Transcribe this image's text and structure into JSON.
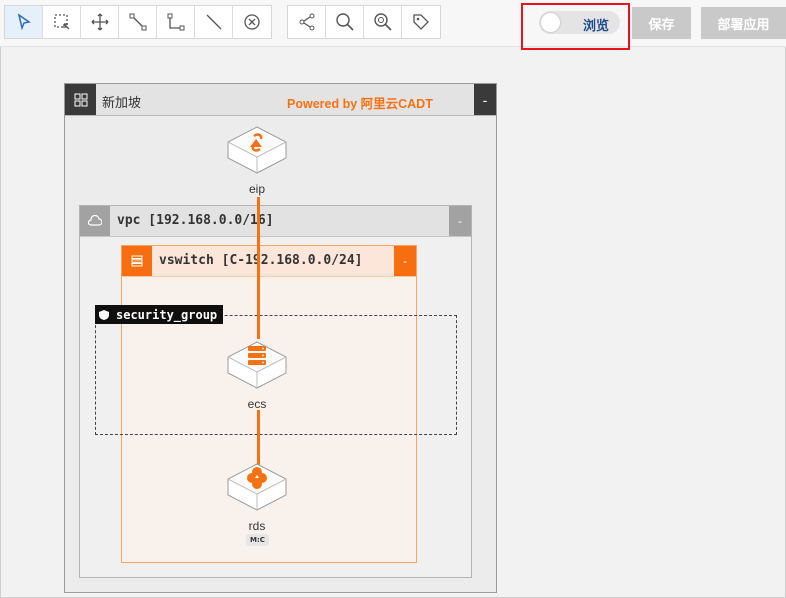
{
  "toolbar": {
    "tools": [
      {
        "icon": "cursor-select-icon",
        "active": true
      },
      {
        "icon": "marquee-select-icon",
        "active": false
      },
      {
        "icon": "move-icon",
        "active": false
      },
      {
        "icon": "connect-line-icon",
        "active": false
      },
      {
        "icon": "elbow-connector-icon",
        "active": false
      },
      {
        "icon": "straight-line-icon",
        "active": false
      },
      {
        "icon": "delete-circle-icon",
        "active": false
      }
    ],
    "tools2": [
      {
        "icon": "share-icon"
      },
      {
        "icon": "zoom-icon"
      },
      {
        "icon": "zoom-fit-icon"
      },
      {
        "icon": "tag-icon"
      }
    ],
    "browse_toggle_label": "浏览",
    "save_label": "保存",
    "deploy_label": "部署应用"
  },
  "canvas": {
    "region": {
      "name": "新加坡",
      "powered_by": "Powered by 阿里云CADT",
      "collapse": "-"
    },
    "vpc": {
      "name": "vpc [192.168.0.0/16]",
      "collapse": "-"
    },
    "vswitch": {
      "name": "vswitch [C-192.168.0.0/24]",
      "collapse": "-"
    },
    "security_group": {
      "name": "security_group"
    },
    "nodes": {
      "eip": {
        "label": "eip",
        "icon": "eip-icon"
      },
      "ecs": {
        "label": "ecs",
        "icon": "ecs-server-icon"
      },
      "rds": {
        "label": "rds",
        "icon": "rds-database-icon",
        "badge": "M:C"
      }
    }
  },
  "colors": {
    "accent": "#f57214",
    "highlight": "#e8141b",
    "toggle_text": "#1f4e8c"
  }
}
